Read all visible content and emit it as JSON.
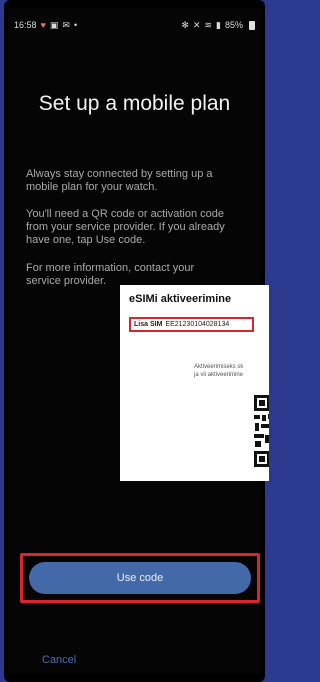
{
  "status_bar": {
    "time": "16:58",
    "left_icons": [
      "heart-icon",
      "gallery-icon",
      "messages-icon"
    ],
    "right_text": "85%"
  },
  "main": {
    "title": "Set up a mobile plan",
    "paragraph1": "Always stay connected by setting up a mobile plan for your watch.",
    "paragraph2": "You'll need a QR code or activation code from your service provider. If you already have one, tap Use code.",
    "paragraph3": "For more information, contact your service provider."
  },
  "esim_card": {
    "title": "eSIMi aktiveerimine",
    "sim_label": "Lisa SIM",
    "sim_number": "EE21230104028134",
    "activation_text_line1": "Aktiveerimiseks sk",
    "activation_text_line2": "ja vii aktiveerimine"
  },
  "buttons": {
    "use_code": "Use code",
    "cancel": "Cancel"
  },
  "colors": {
    "highlight_border": "#d9252d",
    "primary_button": "#4469a8",
    "cancel_text": "#4c6fb4"
  }
}
